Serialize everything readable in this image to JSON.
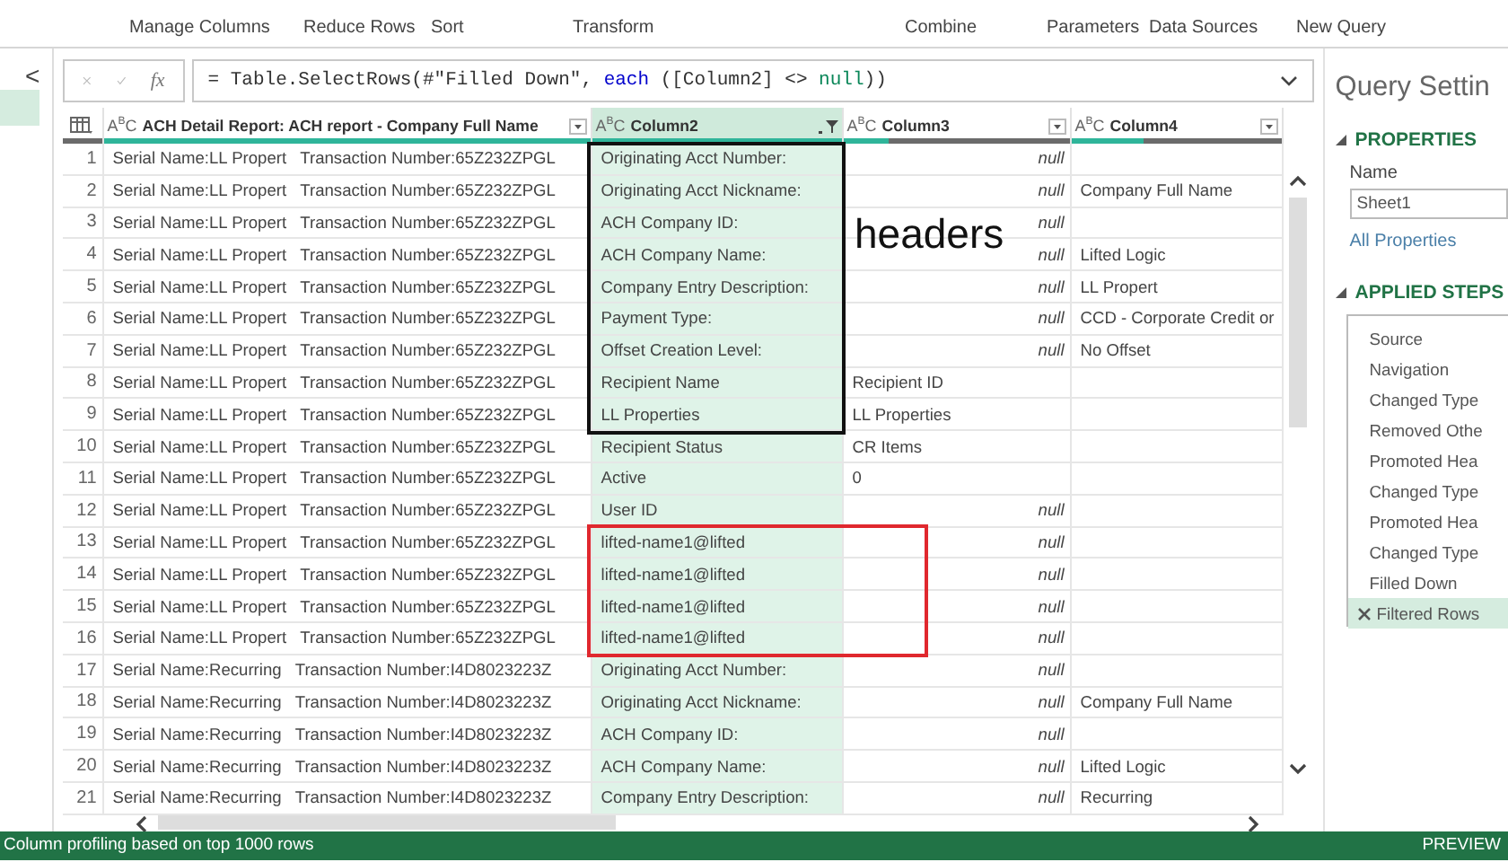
{
  "ribbon": {
    "groups": [
      "Manage Columns",
      "Reduce Rows",
      "Sort",
      "Transform",
      "Combine",
      "Parameters",
      "Data Sources",
      "New Query"
    ]
  },
  "queries_pane": {
    "collapse_glyph": "<",
    "selected": true
  },
  "formula_bar": {
    "fx_label": "fx",
    "parts": [
      {
        "kind": "plain",
        "text": "= Table.SelectRows(#\"Filled Down\", "
      },
      {
        "kind": "keyword",
        "text": "each"
      },
      {
        "kind": "plain",
        "text": " ([Column2] <> "
      },
      {
        "kind": "literal",
        "text": "null"
      },
      {
        "kind": "plain",
        "text": "))"
      }
    ]
  },
  "table": {
    "columns": [
      {
        "type_label": "A$^{B}$C",
        "name": "ACH Detail Report: ACH report - Company Full Name",
        "selected": false,
        "filtered": false,
        "level": 1
      },
      {
        "type_label": "A$^{B}$C",
        "name": "Column2",
        "selected": true,
        "filtered": true,
        "level": 1
      },
      {
        "type_label": "A$^{B}$C",
        "name": "Column3",
        "selected": false,
        "filtered": false,
        "level": 0.2
      },
      {
        "type_label": "A$^{B}$C",
        "name": "Column4",
        "selected": false,
        "filtered": false,
        "level": 0.34
      }
    ],
    "rows": [
      {
        "number": "1",
        "cells": [
          "Serial Name:LL Propert   Transaction Number:65Z232ZPGL",
          "Originating Acct Number:",
          {
            "kind": "null",
            "text": "null"
          },
          ""
        ]
      },
      {
        "number": "2",
        "cells": [
          "Serial Name:LL Propert   Transaction Number:65Z232ZPGL",
          "Originating Acct Nickname:",
          {
            "kind": "null",
            "text": "null"
          },
          "Company Full Name"
        ]
      },
      {
        "number": "3",
        "cells": [
          "Serial Name:LL Propert   Transaction Number:65Z232ZPGL",
          "ACH Company ID:",
          {
            "kind": "null",
            "text": "null"
          },
          ""
        ]
      },
      {
        "number": "4",
        "cells": [
          "Serial Name:LL Propert   Transaction Number:65Z232ZPGL",
          "ACH Company Name:",
          {
            "kind": "null",
            "text": "null"
          },
          "Lifted Logic"
        ]
      },
      {
        "number": "5",
        "cells": [
          "Serial Name:LL Propert   Transaction Number:65Z232ZPGL",
          "Company Entry Description:",
          {
            "kind": "null",
            "text": "null"
          },
          "LL Propert"
        ]
      },
      {
        "number": "6",
        "cells": [
          "Serial Name:LL Propert   Transaction Number:65Z232ZPGL",
          "Payment Type:",
          {
            "kind": "null",
            "text": "null"
          },
          "CCD - Corporate Credit or"
        ]
      },
      {
        "number": "7",
        "cells": [
          "Serial Name:LL Propert   Transaction Number:65Z232ZPGL",
          "Offset Creation Level:",
          {
            "kind": "null",
            "text": "null"
          },
          "No Offset"
        ]
      },
      {
        "number": "8",
        "cells": [
          "Serial Name:LL Propert   Transaction Number:65Z232ZPGL",
          "Recipient Name",
          {
            "kind": "text",
            "text": "Recipient ID"
          },
          ""
        ]
      },
      {
        "number": "9",
        "cells": [
          "Serial Name:LL Propert   Transaction Number:65Z232ZPGL",
          "LL Properties",
          {
            "kind": "text",
            "text": "LL Properties"
          },
          ""
        ]
      },
      {
        "number": "10",
        "cells": [
          "Serial Name:LL Propert   Transaction Number:65Z232ZPGL",
          "Recipient Status",
          {
            "kind": "text",
            "text": "CR Items"
          },
          ""
        ]
      },
      {
        "number": "11",
        "cells": [
          "Serial Name:LL Propert   Transaction Number:65Z232ZPGL",
          "Active",
          {
            "kind": "text",
            "text": "0"
          },
          ""
        ]
      },
      {
        "number": "12",
        "cells": [
          "Serial Name:LL Propert   Transaction Number:65Z232ZPGL",
          "User ID",
          {
            "kind": "null",
            "text": "null"
          },
          ""
        ]
      },
      {
        "number": "13",
        "cells": [
          "Serial Name:LL Propert   Transaction Number:65Z232ZPGL",
          "lifted-name1@lifted",
          {
            "kind": "null",
            "text": "null"
          },
          ""
        ]
      },
      {
        "number": "14",
        "cells": [
          "Serial Name:LL Propert   Transaction Number:65Z232ZPGL",
          "lifted-name1@lifted",
          {
            "kind": "null",
            "text": "null"
          },
          ""
        ]
      },
      {
        "number": "15",
        "cells": [
          "Serial Name:LL Propert   Transaction Number:65Z232ZPGL",
          "lifted-name1@lifted",
          {
            "kind": "null",
            "text": "null"
          },
          ""
        ]
      },
      {
        "number": "16",
        "cells": [
          "Serial Name:LL Propert   Transaction Number:65Z232ZPGL",
          "lifted-name1@lifted",
          {
            "kind": "null",
            "text": "null"
          },
          ""
        ]
      },
      {
        "number": "17",
        "cells": [
          "Serial Name:Recurring   Transaction Number:I4D8023223Z",
          "Originating Acct Number:",
          {
            "kind": "null",
            "text": "null"
          },
          ""
        ]
      },
      {
        "number": "18",
        "cells": [
          "Serial Name:Recurring   Transaction Number:I4D8023223Z",
          "Originating Acct Nickname:",
          {
            "kind": "null",
            "text": "null"
          },
          "Company Full Name"
        ]
      },
      {
        "number": "19",
        "cells": [
          "Serial Name:Recurring   Transaction Number:I4D8023223Z",
          "ACH Company ID:",
          {
            "kind": "null",
            "text": "null"
          },
          ""
        ]
      },
      {
        "number": "20",
        "cells": [
          "Serial Name:Recurring   Transaction Number:I4D8023223Z",
          "ACH Company Name:",
          {
            "kind": "null",
            "text": "null"
          },
          "Lifted Logic"
        ]
      },
      {
        "number": "21",
        "cells": [
          "Serial Name:Recurring   Transaction Number:I4D8023223Z",
          "Company Entry Description:",
          {
            "kind": "null",
            "text": "null"
          },
          "Recurring"
        ]
      }
    ]
  },
  "annotations": [
    {
      "kind": "label",
      "text": "headers"
    },
    {
      "kind": "box",
      "color": "#111111"
    },
    {
      "kind": "box",
      "color": "#e0282e"
    }
  ],
  "query_settings": {
    "title": "Query Settin",
    "properties_heading": "PROPERTIES",
    "name_label": "Name",
    "name_value": "Sheet1",
    "all_properties_link": "All Properties",
    "steps_heading": "APPLIED STEPS",
    "steps": [
      {
        "label": "Source",
        "selected": false
      },
      {
        "label": "Navigation",
        "selected": false
      },
      {
        "label": "Changed Type",
        "selected": false
      },
      {
        "label": "Removed Othe",
        "selected": false
      },
      {
        "label": "Promoted Hea",
        "selected": false
      },
      {
        "label": "Changed Type",
        "selected": false
      },
      {
        "label": "Promoted Hea",
        "selected": false
      },
      {
        "label": "Changed Type",
        "selected": false
      },
      {
        "label": "Filled Down",
        "selected": false
      },
      {
        "label": "Filtered Rows",
        "selected": true
      }
    ]
  },
  "status_bar": {
    "message": "Column profiling based on top 1000 rows",
    "mode": "PREVIEW"
  }
}
